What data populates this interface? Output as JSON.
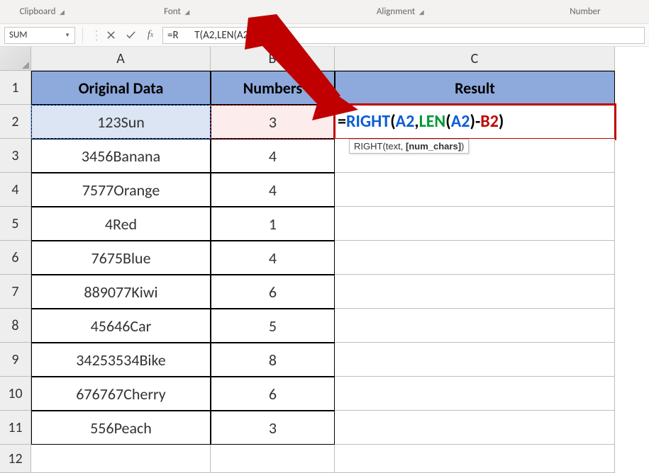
{
  "ribbon": {
    "groups": [
      "Clipboard",
      "Font",
      "Alignment",
      "Number"
    ]
  },
  "name_box": "SUM",
  "formula_bar": "=RIGHT(A2,LEN(A2)-B2)",
  "formula_bar_visible_prefix": "=R",
  "formula_bar_visible_suffix": "T(A2,LEN(A2)-B2)",
  "columns": [
    "A",
    "B",
    "C"
  ],
  "rows": [
    1,
    2,
    3,
    4,
    5,
    6,
    7,
    8,
    9,
    10,
    11,
    12
  ],
  "headers": {
    "A": "Original Data",
    "B": "Numbers",
    "C": "Result"
  },
  "table": [
    {
      "A": "123Sun",
      "B": "3"
    },
    {
      "A": "3456Banana",
      "B": "4"
    },
    {
      "A": "7577Orange",
      "B": "4"
    },
    {
      "A": "4Red",
      "B": "1"
    },
    {
      "A": "7675Blue",
      "B": "4"
    },
    {
      "A": "889077Kiwi",
      "B": "6"
    },
    {
      "A": "45646Car",
      "B": "5"
    },
    {
      "A": "34253534Bike",
      "B": "8"
    },
    {
      "A": "676767Cherry",
      "B": "6"
    },
    {
      "A": "556Peach",
      "B": "3"
    }
  ],
  "formula_cell": {
    "parts": {
      "eq": "=",
      "fn1": "RIGHT",
      "open1": "(",
      "arg1": "A2",
      "comma": ",",
      "fn2": "LEN",
      "open2": "(",
      "arg2": "A2",
      "close2": ")",
      "minus": "-",
      "arg3": "B2",
      "close1": ")"
    }
  },
  "tooltip": {
    "fn": "RIGHT",
    "open": "(",
    "arg1": "text",
    "sep": ", ",
    "arg2": "[num_chars]",
    "close": ")"
  }
}
